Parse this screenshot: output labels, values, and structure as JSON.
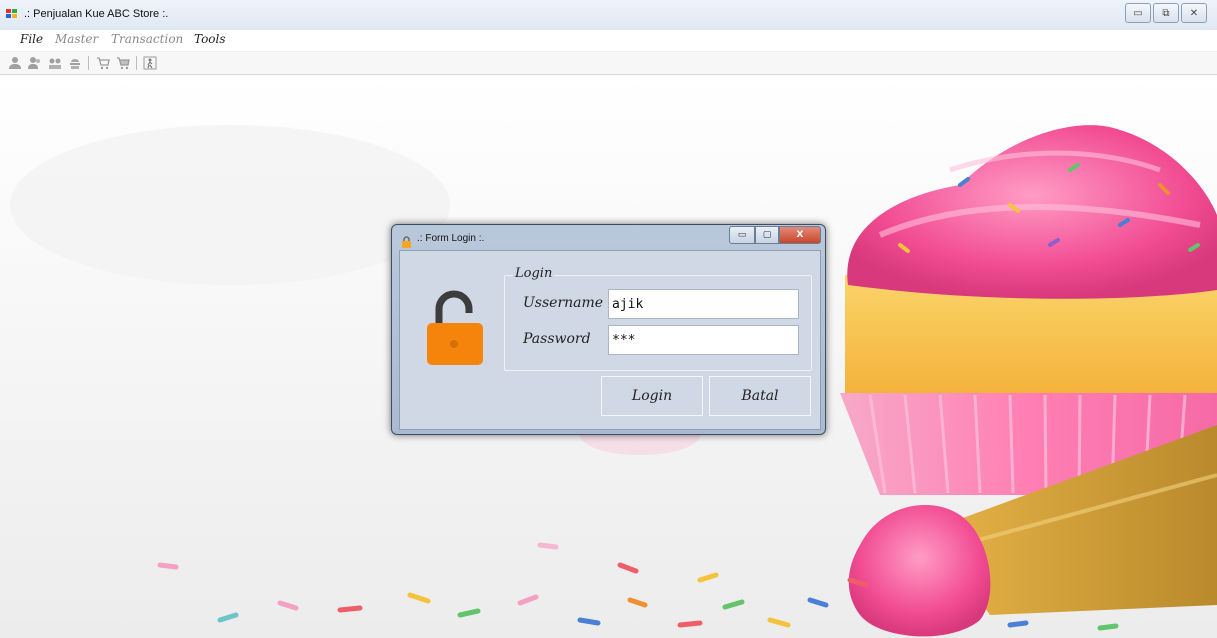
{
  "window": {
    "title": ".: Penjualan Kue ABC Store :.",
    "min_glyph": "▭",
    "max_glyph": "⧉",
    "close_glyph": "✕"
  },
  "menu": {
    "items": [
      {
        "label": "File",
        "color": "#222222"
      },
      {
        "label": "Master",
        "color": "#888888"
      },
      {
        "label": "Transaction",
        "color": "#888888"
      },
      {
        "label": "Tools",
        "color": "#222222"
      }
    ]
  },
  "toolbar": {
    "icons": [
      "user-icon",
      "users-icon",
      "user-group-icon",
      "cake-icon",
      "cart-icon",
      "cart-full-icon",
      "exit-icon"
    ]
  },
  "login_dialog": {
    "title": ".: Form Login :.",
    "group_label": "Login",
    "username_label": "Ussername",
    "username_value": "ajik",
    "password_label": "Password",
    "password_value": "***",
    "login_button": "Login",
    "cancel_button": "Batal",
    "min_glyph": "▭",
    "max_glyph": "▢",
    "close_glyph": "X"
  },
  "colors": {
    "lock_orange": "#f5840d",
    "close_red": "#c9462c",
    "frosting_pink": "#f24c93",
    "cake_yellow": "#f8c54d"
  }
}
